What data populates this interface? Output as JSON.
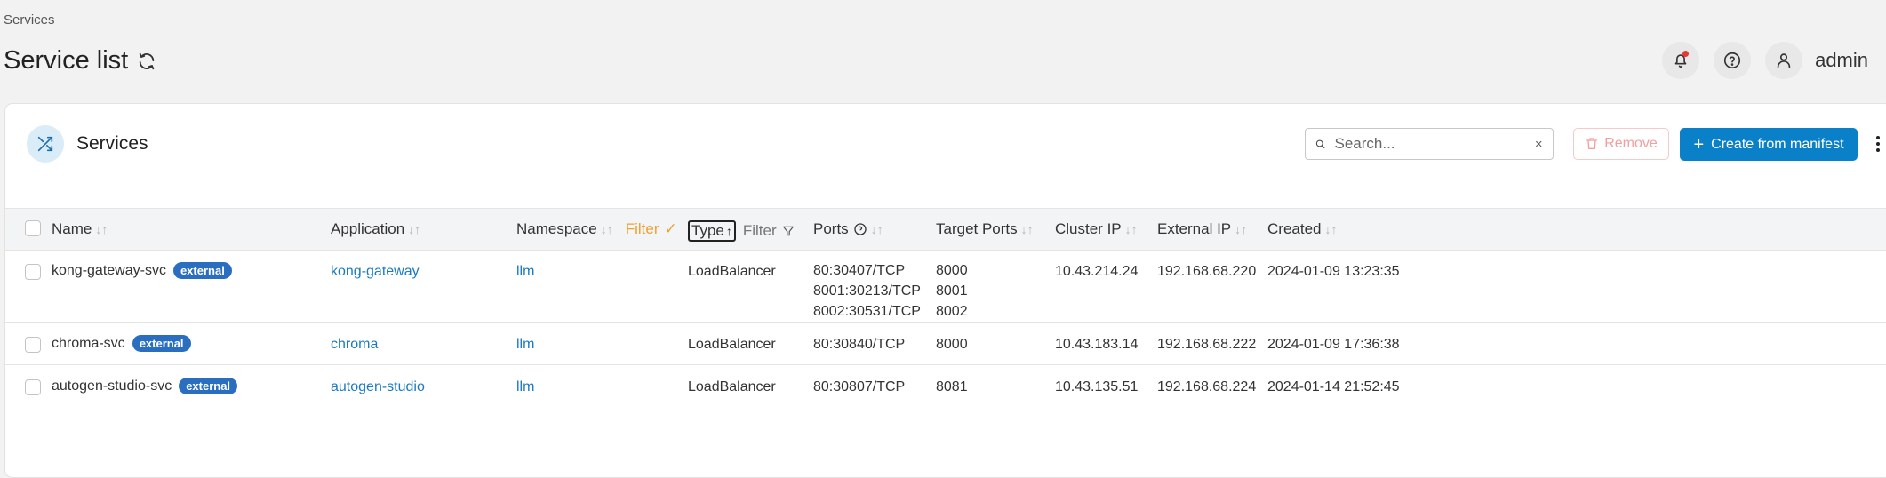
{
  "breadcrumb": "Services",
  "page_title": "Service list",
  "user": {
    "name": "admin"
  },
  "panel": {
    "title": "Services",
    "search_placeholder": "Search...",
    "remove_label": "Remove",
    "create_label": "Create from manifest"
  },
  "table": {
    "headers": {
      "name": "Name",
      "application": "Application",
      "namespace": "Namespace",
      "namespace_filter": "Filter",
      "type": "Type",
      "type_filter": "Filter",
      "ports": "Ports",
      "target_ports": "Target Ports",
      "cluster_ip": "Cluster IP",
      "external_ip": "External IP",
      "created": "Created"
    },
    "rows": [
      {
        "name": "kong-gateway-svc",
        "badge": "external",
        "application": "kong-gateway",
        "namespace": "llm",
        "type": "LoadBalancer",
        "ports": [
          "80:30407/TCP",
          "8001:30213/TCP",
          "8002:30531/TCP"
        ],
        "target_ports": [
          "8000",
          "8001",
          "8002"
        ],
        "cluster_ip": "10.43.214.24",
        "external_ip": "192.168.68.220",
        "created": "2024-01-09 13:23:35"
      },
      {
        "name": "chroma-svc",
        "badge": "external",
        "application": "chroma",
        "namespace": "llm",
        "type": "LoadBalancer",
        "ports": [
          "80:30840/TCP"
        ],
        "target_ports": [
          "8000"
        ],
        "cluster_ip": "10.43.183.14",
        "external_ip": "192.168.68.222",
        "created": "2024-01-09 17:36:38"
      },
      {
        "name": "autogen-studio-svc",
        "badge": "external",
        "application": "autogen-studio",
        "namespace": "llm",
        "type": "LoadBalancer",
        "ports": [
          "80:30807/TCP"
        ],
        "target_ports": [
          "8081"
        ],
        "cluster_ip": "10.43.135.51",
        "external_ip": "192.168.68.224",
        "created": "2024-01-14 21:52:45"
      }
    ]
  }
}
